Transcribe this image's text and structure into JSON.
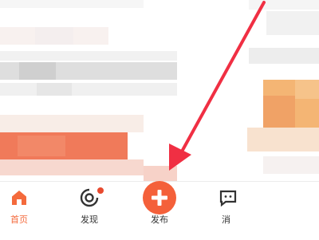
{
  "tabbar": {
    "items": [
      {
        "label": "首页",
        "icon": "home-icon",
        "active": true
      },
      {
        "label": "发现",
        "icon": "discover-icon",
        "active": false,
        "has_dot": true
      },
      {
        "label": "发布",
        "icon": "plus-icon",
        "active": false
      },
      {
        "label": "消",
        "icon": "message-icon",
        "active": false
      }
    ]
  },
  "colors": {
    "accent": "#f46a3c",
    "publish_button": "#f4603a",
    "annotation_arrow": "#f02f43",
    "inactive_text": "#333333",
    "badge": "#e84a2f"
  }
}
